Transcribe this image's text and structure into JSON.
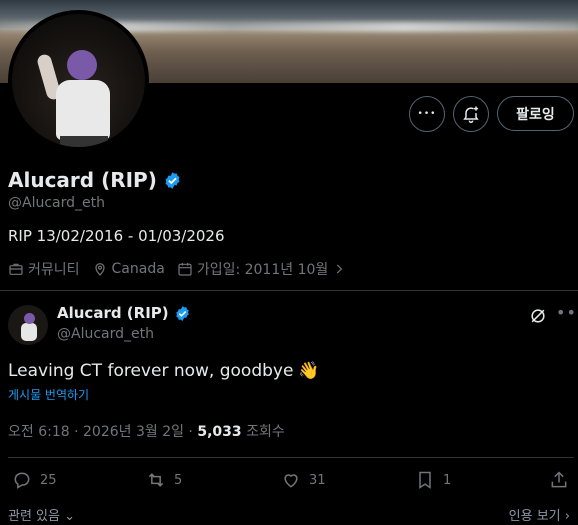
{
  "profile": {
    "display_name": "Alucard (RIP)",
    "handle": "@Alucard_eth",
    "bio": "RIP 13/02/2016 - 01/03/2026",
    "category": "커뮤니티",
    "location": "Canada",
    "joined": "가입일: 2011년 10월"
  },
  "buttons": {
    "more": "•••",
    "follow": "팔로잉"
  },
  "tweet": {
    "display_name": "Alucard (RIP)",
    "handle": "@Alucard_eth",
    "text": "Leaving CT forever now, goodbye",
    "emoji": "👋",
    "translate": "게시물 번역하기",
    "time": "오전 6:18 · 2026년 3월 2일 · ",
    "views_count": "5,033",
    "views_label": " 조회수"
  },
  "actions": {
    "replies": "25",
    "reposts": "5",
    "likes": "31",
    "bookmarks": "1"
  },
  "footer": {
    "left": "관련 있음",
    "right": "인용 보기"
  },
  "colors": {
    "accent": "#1d9bf0",
    "muted": "#71767b",
    "text": "#e7e9ea"
  }
}
